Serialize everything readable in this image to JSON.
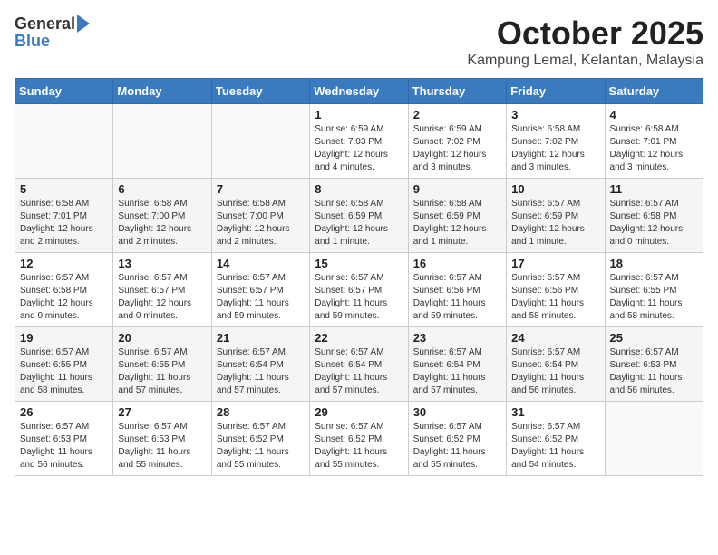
{
  "header": {
    "logo_general": "General",
    "logo_blue": "Blue",
    "month_title": "October 2025",
    "location": "Kampung Lemal, Kelantan, Malaysia"
  },
  "weekdays": [
    "Sunday",
    "Monday",
    "Tuesday",
    "Wednesday",
    "Thursday",
    "Friday",
    "Saturday"
  ],
  "weeks": [
    [
      {
        "day": "",
        "info": ""
      },
      {
        "day": "",
        "info": ""
      },
      {
        "day": "",
        "info": ""
      },
      {
        "day": "1",
        "info": "Sunrise: 6:59 AM\nSunset: 7:03 PM\nDaylight: 12 hours and 4 minutes."
      },
      {
        "day": "2",
        "info": "Sunrise: 6:59 AM\nSunset: 7:02 PM\nDaylight: 12 hours and 3 minutes."
      },
      {
        "day": "3",
        "info": "Sunrise: 6:58 AM\nSunset: 7:02 PM\nDaylight: 12 hours and 3 minutes."
      },
      {
        "day": "4",
        "info": "Sunrise: 6:58 AM\nSunset: 7:01 PM\nDaylight: 12 hours and 3 minutes."
      }
    ],
    [
      {
        "day": "5",
        "info": "Sunrise: 6:58 AM\nSunset: 7:01 PM\nDaylight: 12 hours and 2 minutes."
      },
      {
        "day": "6",
        "info": "Sunrise: 6:58 AM\nSunset: 7:00 PM\nDaylight: 12 hours and 2 minutes."
      },
      {
        "day": "7",
        "info": "Sunrise: 6:58 AM\nSunset: 7:00 PM\nDaylight: 12 hours and 2 minutes."
      },
      {
        "day": "8",
        "info": "Sunrise: 6:58 AM\nSunset: 6:59 PM\nDaylight: 12 hours and 1 minute."
      },
      {
        "day": "9",
        "info": "Sunrise: 6:58 AM\nSunset: 6:59 PM\nDaylight: 12 hours and 1 minute."
      },
      {
        "day": "10",
        "info": "Sunrise: 6:57 AM\nSunset: 6:59 PM\nDaylight: 12 hours and 1 minute."
      },
      {
        "day": "11",
        "info": "Sunrise: 6:57 AM\nSunset: 6:58 PM\nDaylight: 12 hours and 0 minutes."
      }
    ],
    [
      {
        "day": "12",
        "info": "Sunrise: 6:57 AM\nSunset: 6:58 PM\nDaylight: 12 hours and 0 minutes."
      },
      {
        "day": "13",
        "info": "Sunrise: 6:57 AM\nSunset: 6:57 PM\nDaylight: 12 hours and 0 minutes."
      },
      {
        "day": "14",
        "info": "Sunrise: 6:57 AM\nSunset: 6:57 PM\nDaylight: 11 hours and 59 minutes."
      },
      {
        "day": "15",
        "info": "Sunrise: 6:57 AM\nSunset: 6:57 PM\nDaylight: 11 hours and 59 minutes."
      },
      {
        "day": "16",
        "info": "Sunrise: 6:57 AM\nSunset: 6:56 PM\nDaylight: 11 hours and 59 minutes."
      },
      {
        "day": "17",
        "info": "Sunrise: 6:57 AM\nSunset: 6:56 PM\nDaylight: 11 hours and 58 minutes."
      },
      {
        "day": "18",
        "info": "Sunrise: 6:57 AM\nSunset: 6:55 PM\nDaylight: 11 hours and 58 minutes."
      }
    ],
    [
      {
        "day": "19",
        "info": "Sunrise: 6:57 AM\nSunset: 6:55 PM\nDaylight: 11 hours and 58 minutes."
      },
      {
        "day": "20",
        "info": "Sunrise: 6:57 AM\nSunset: 6:55 PM\nDaylight: 11 hours and 57 minutes."
      },
      {
        "day": "21",
        "info": "Sunrise: 6:57 AM\nSunset: 6:54 PM\nDaylight: 11 hours and 57 minutes."
      },
      {
        "day": "22",
        "info": "Sunrise: 6:57 AM\nSunset: 6:54 PM\nDaylight: 11 hours and 57 minutes."
      },
      {
        "day": "23",
        "info": "Sunrise: 6:57 AM\nSunset: 6:54 PM\nDaylight: 11 hours and 57 minutes."
      },
      {
        "day": "24",
        "info": "Sunrise: 6:57 AM\nSunset: 6:54 PM\nDaylight: 11 hours and 56 minutes."
      },
      {
        "day": "25",
        "info": "Sunrise: 6:57 AM\nSunset: 6:53 PM\nDaylight: 11 hours and 56 minutes."
      }
    ],
    [
      {
        "day": "26",
        "info": "Sunrise: 6:57 AM\nSunset: 6:53 PM\nDaylight: 11 hours and 56 minutes."
      },
      {
        "day": "27",
        "info": "Sunrise: 6:57 AM\nSunset: 6:53 PM\nDaylight: 11 hours and 55 minutes."
      },
      {
        "day": "28",
        "info": "Sunrise: 6:57 AM\nSunset: 6:52 PM\nDaylight: 11 hours and 55 minutes."
      },
      {
        "day": "29",
        "info": "Sunrise: 6:57 AM\nSunset: 6:52 PM\nDaylight: 11 hours and 55 minutes."
      },
      {
        "day": "30",
        "info": "Sunrise: 6:57 AM\nSunset: 6:52 PM\nDaylight: 11 hours and 55 minutes."
      },
      {
        "day": "31",
        "info": "Sunrise: 6:57 AM\nSunset: 6:52 PM\nDaylight: 11 hours and 54 minutes."
      },
      {
        "day": "",
        "info": ""
      }
    ]
  ]
}
